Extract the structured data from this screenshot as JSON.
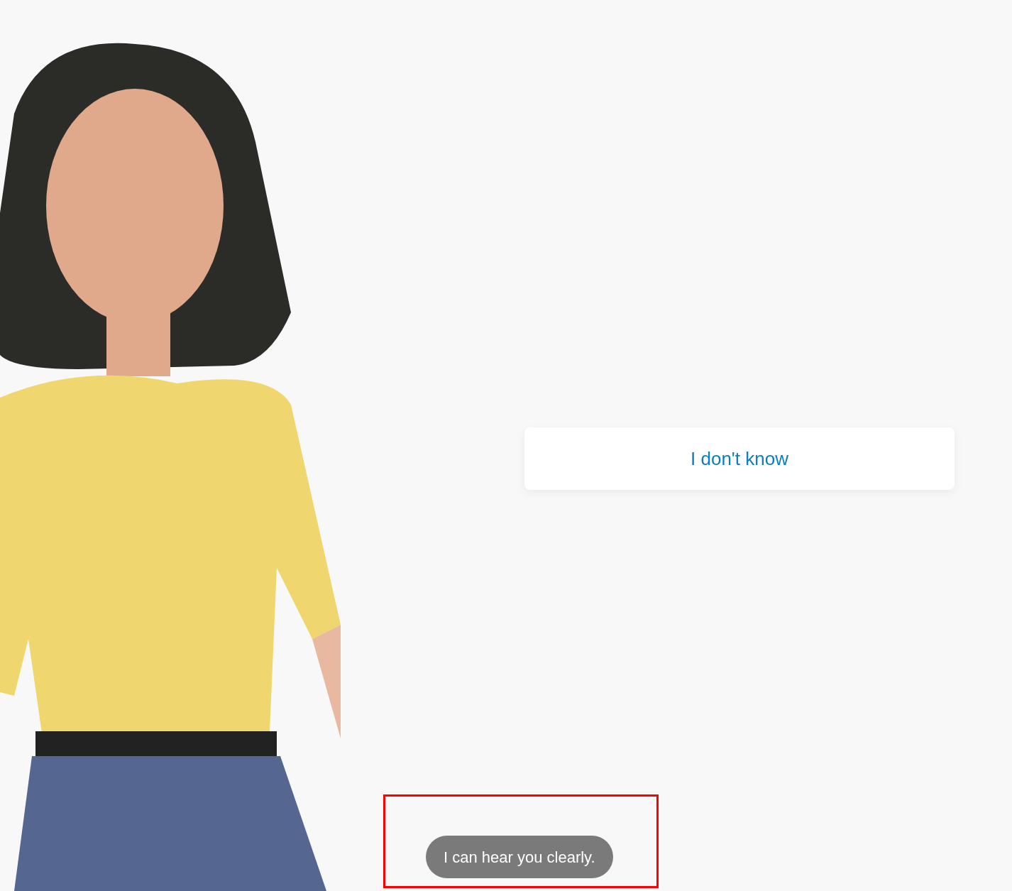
{
  "answer_options": [
    {
      "label": "I don't know"
    }
  ],
  "caption": {
    "text": "I can hear you clearly."
  }
}
